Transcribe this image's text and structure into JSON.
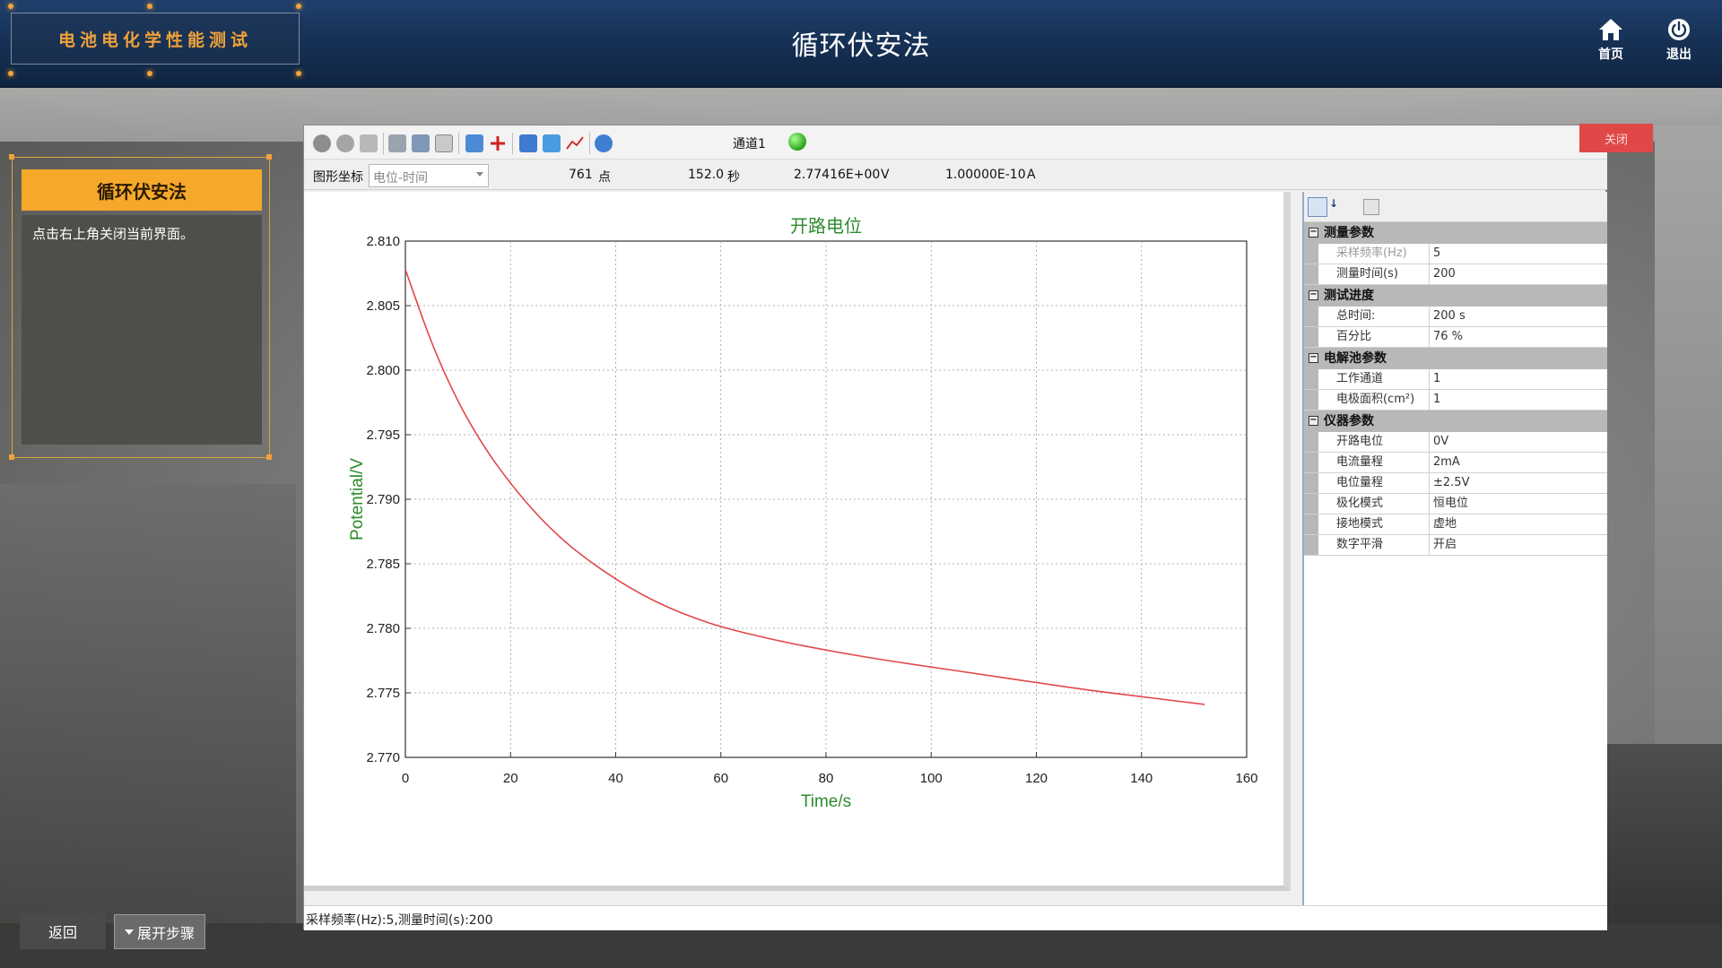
{
  "header": {
    "logo_text": "电池电化学性能测试",
    "title": "循环伏安法",
    "home_label": "首页",
    "exit_label": "退出"
  },
  "step_panel": {
    "title": "循环伏安法",
    "instruction": "点击右上角关闭当前界面。"
  },
  "bottom": {
    "back_label": "返回",
    "expand_label": "展开步骤"
  },
  "app": {
    "channel_label": "通道1",
    "close_label": "关闭",
    "infobar": {
      "coord_label": "图形坐标",
      "coord_mode": "电位-时间",
      "points": "761",
      "points_unit": "点",
      "seconds": "152.0",
      "seconds_unit": "秒",
      "voltage": "2.77416E+00",
      "voltage_unit": "V",
      "current": "1.00000E-10",
      "current_unit": "A"
    },
    "status_text": "采样频率(Hz):5,测量时间(s):200"
  },
  "properties": [
    {
      "category": "测量参数",
      "rows": [
        {
          "key": "采样频率(Hz)",
          "value": "5",
          "dim": true
        },
        {
          "key": "测量时间(s)",
          "value": "200",
          "dim": false
        }
      ]
    },
    {
      "category": "测试进度",
      "rows": [
        {
          "key": "总时间:",
          "value": "200 s",
          "dim": false
        },
        {
          "key": "百分比",
          "value": "76 %",
          "dim": false
        }
      ]
    },
    {
      "category": "电解池参数",
      "rows": [
        {
          "key": "工作通道",
          "value": "1",
          "dim": false
        },
        {
          "key": "电极面积(cm²)",
          "value": "1",
          "dim": false
        }
      ]
    },
    {
      "category": "仪器参数",
      "rows": [
        {
          "key": "开路电位",
          "value": "0V",
          "dim": false
        },
        {
          "key": "电流量程",
          "value": "2mA",
          "dim": false
        },
        {
          "key": "电位量程",
          "value": "±2.5V",
          "dim": false
        },
        {
          "key": "极化模式",
          "value": "恒电位",
          "dim": false
        },
        {
          "key": "接地模式",
          "value": "虚地",
          "dim": false
        },
        {
          "key": "数字平滑",
          "value": "开启",
          "dim": false
        }
      ]
    }
  ],
  "chart_data": {
    "type": "line",
    "title": "开路电位",
    "xlabel": "Time/s",
    "ylabel": "Potential/V",
    "xlim": [
      0,
      160
    ],
    "ylim": [
      2.77,
      2.81
    ],
    "xticks": [
      "0",
      "20",
      "40",
      "60",
      "80",
      "100",
      "120",
      "140",
      "160"
    ],
    "yticks": [
      "2.770",
      "2.775",
      "2.780",
      "2.785",
      "2.790",
      "2.795",
      "2.800",
      "2.805",
      "2.810"
    ],
    "grid": true,
    "colors": {
      "line": "#e24848",
      "title": "#2e8b2e",
      "axis_label": "#2e8b2e"
    },
    "series": [
      {
        "x": [
          0,
          5,
          10,
          15,
          20,
          25,
          30,
          35,
          40,
          45,
          50,
          55,
          60,
          70,
          80,
          90,
          100,
          110,
          120,
          130,
          140,
          152
        ],
        "y": [
          2.8078,
          2.802,
          2.7975,
          2.794,
          2.7912,
          2.7888,
          2.7868,
          2.7852,
          2.7838,
          2.7826,
          2.7816,
          2.7808,
          2.7801,
          2.7791,
          2.7783,
          2.7776,
          2.777,
          2.7764,
          2.7758,
          2.7752,
          2.7747,
          2.7741
        ]
      }
    ]
  }
}
